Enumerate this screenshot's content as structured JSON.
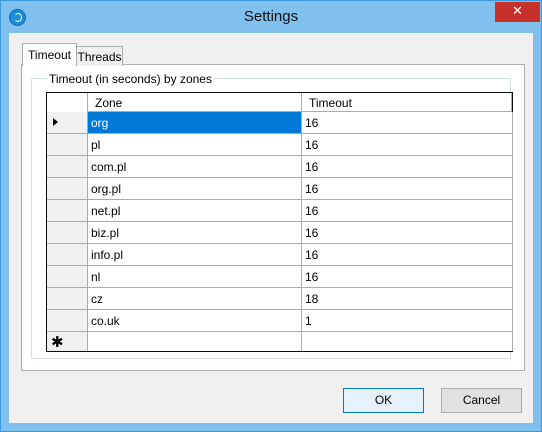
{
  "window": {
    "title": "Settings",
    "close_glyph": "✕",
    "accent_color": "#7fc0ee"
  },
  "tabs": [
    {
      "label": "Timeout",
      "active": true
    },
    {
      "label": "Threads",
      "active": false
    }
  ],
  "group": {
    "title": "Timeout (in seconds) by zones"
  },
  "grid": {
    "columns": [
      "Zone",
      "Timeout"
    ],
    "rows": [
      {
        "zone": "org",
        "timeout": "16"
      },
      {
        "zone": "pl",
        "timeout": "16"
      },
      {
        "zone": "com.pl",
        "timeout": "16"
      },
      {
        "zone": "org.pl",
        "timeout": "16"
      },
      {
        "zone": "net.pl",
        "timeout": "16"
      },
      {
        "zone": "biz.pl",
        "timeout": "16"
      },
      {
        "zone": "info.pl",
        "timeout": "16"
      },
      {
        "zone": "nl",
        "timeout": "16"
      },
      {
        "zone": "cz",
        "timeout": "18"
      },
      {
        "zone": "co.uk",
        "timeout": "1"
      }
    ],
    "new_row_marker": "✱",
    "selected_color": "#0078d7"
  },
  "buttons": {
    "ok": "OK",
    "cancel": "Cancel"
  }
}
